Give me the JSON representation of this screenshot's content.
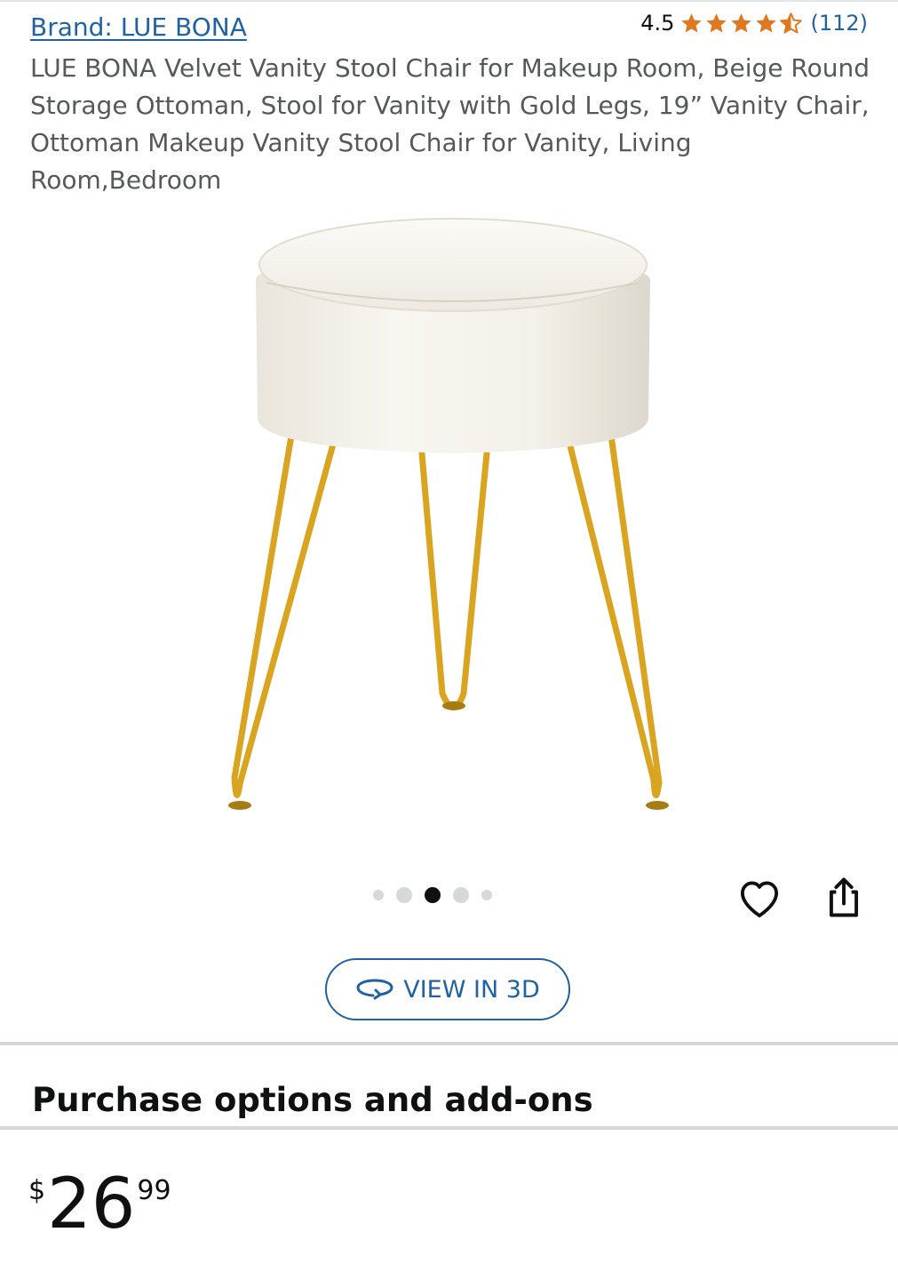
{
  "brand": {
    "label": "Brand: LUE BONA"
  },
  "rating": {
    "score": "4.5",
    "stars": 4.5,
    "count": "(112)"
  },
  "product": {
    "title": "LUE BONA Velvet Vanity Stool Chair for Makeup Room, Beige Round Storage Ottoman, Stool for Vanity with Gold Legs, 19” Vanity Chair, Ottoman Makeup Vanity Stool Chair for Vanity, Living Room,Bedroom"
  },
  "gallery": {
    "total_dots": 5,
    "active_index": 2
  },
  "actions": {
    "wishlist_icon": "heart-icon",
    "share_icon": "share-icon"
  },
  "view3d": {
    "label": "VIEW IN 3D",
    "icon": "rotate-3d-icon"
  },
  "section": {
    "title": "Purchase options and add-ons"
  },
  "price": {
    "symbol": "$",
    "whole": "26",
    "fraction": "99"
  },
  "colors": {
    "link": "#2162a1",
    "star": "#de7921",
    "gold_legs": "#d9a521",
    "cushion": "#f6f3ec"
  }
}
